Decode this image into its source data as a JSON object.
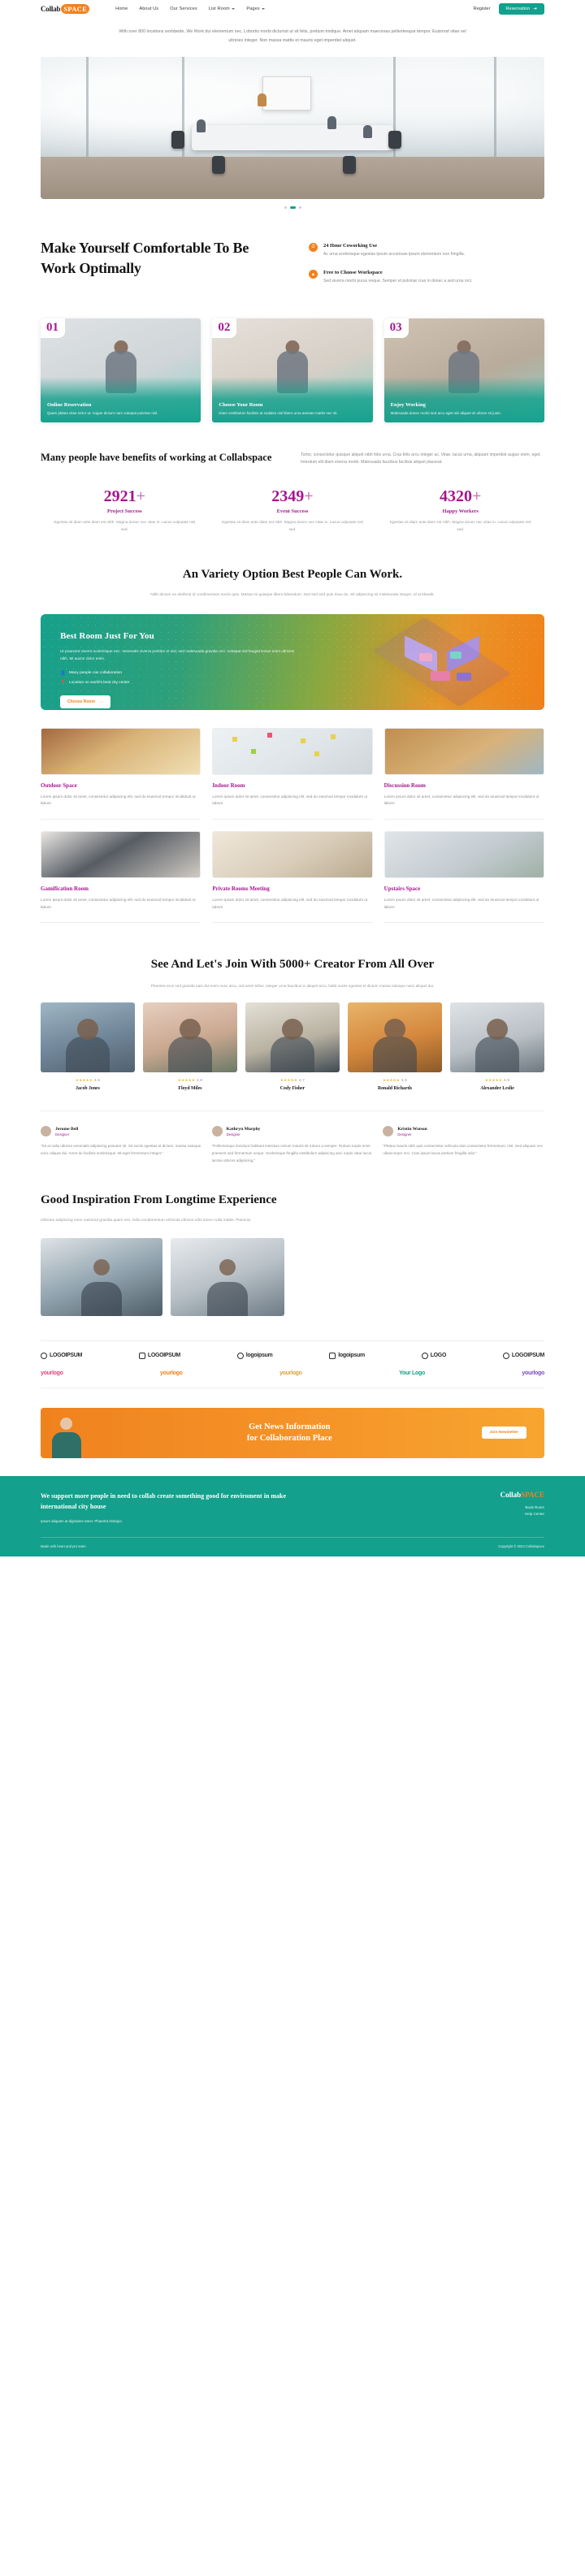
{
  "brand": {
    "name_dark": "Collab",
    "name_light": "SPACE",
    "accent_teal": "#13a08c",
    "accent_orange": "#f0821e",
    "accent_magenta": "#a4168f"
  },
  "header": {
    "nav": [
      {
        "label": "Home",
        "caret": false
      },
      {
        "label": "About Us",
        "caret": false
      },
      {
        "label": "Our Services",
        "caret": false
      },
      {
        "label": "List Room",
        "caret": true
      },
      {
        "label": "Pages",
        "caret": true
      }
    ],
    "register_label": "Register",
    "reservation_label": "Reservation",
    "reservation_icon": "arrow-right-icon"
  },
  "hero": {
    "subtitle": "With over 800 locations worldwide, We Work dui elementum nec. Lobortis morbi dictumst ut sit felis, pretium tristique. Amet aliquam maecenas pellentesque tempor. Euismod vitae vel ultricies integer. Non massa mattis et mauris eget imperdiet aliquet.",
    "slider_dots": 3,
    "active_dot": 1
  },
  "comfort": {
    "heading": "Make Yourself Comfortable To Be Work Optimally",
    "features": [
      {
        "icon": "clock-icon",
        "title": "24 Hour Coworking Use",
        "text": "Ac urna scelerisque egestas ipsum accumsan ipsum elementum non fringilla."
      },
      {
        "icon": "chart-icon",
        "title": "Free to Choose Workspace",
        "text": "Sed viverra morbi purus neque. Semper et pulvinar cras in donec a sed urna orci."
      }
    ]
  },
  "steps": [
    {
      "num": "01",
      "title": "Online Reservation",
      "text": "Quam platea vitae tortor ut. Augue dictum nam volutpat pulvinar nisl."
    },
    {
      "num": "02",
      "title": "Choose Your Room",
      "text": "Diam vestibulum facilisis at sodales nisl libero urna aenean mattis nec sit."
    },
    {
      "num": "03",
      "title": "Enjoy Working",
      "text": "Malesuada donec morbi sed arcu eget nisi aliquet sit ultrum sit justo."
    }
  ],
  "benefits": {
    "heading": "Many people have benefits of working at Collabspace",
    "text": "Tortor, consectetur quisque aliquet nibh felis urna. Cras felis arcu integer ac. Vitae, lacus urna, aliquam imperdiet augue enim, eget. Interdum elit diam viverra morbi. Malesuada faucibus facilisis aliquet placerat.",
    "stats": [
      {
        "value": "2921",
        "suffix": "+",
        "label": "Project Success",
        "desc": "Egestas sit diam ante diam est nibh. Magna donec nec vitae in. Lacus vulputate nisl sed."
      },
      {
        "value": "2349",
        "suffix": "+",
        "label": "Event Success",
        "desc": "Egestas sit diam ante diam est nibh. Magna donec nec vitae in. Lacus vulputate nisl sed."
      },
      {
        "value": "4320",
        "suffix": "+",
        "label": "Happy Workers",
        "desc": "Egestas sit diam ante diam est nibh. Magna donec nec vitae in. Lacus vulputate nisl sed."
      }
    ]
  },
  "variety": {
    "heading": "An Variety Option Best People Can Work.",
    "text": "Nibh dictum eu eleifend id condimentum sociis quis. Massa mi quisque libero bibendum. Sed sed sed quis risus do. Sit adipiscing sit malesuada integer. Id at blandit."
  },
  "promo": {
    "title": "Best Room Just For You",
    "text": "Ut praesent viverra scelerisque nec. Venenatis viverra porttitor et nisl, sed malesuada gravida orci. Volutpat nisl feugiat lectus enim ultricies nibh. Mi auctor dolor enim.",
    "bullets": [
      {
        "icon": "user-icon",
        "text": "Many people can collaboration"
      },
      {
        "icon": "location-pin-icon",
        "text": "Location on world's best city center"
      }
    ],
    "button": "Choose Room",
    "button_icon": "arrow-right-icon"
  },
  "rooms": [
    {
      "title": "Outdoor Space",
      "text": "Lorem ipsum dolor sit amet, consectetur adipiscing elit. sed do eiusmod tempor incididunt ut labore"
    },
    {
      "title": "Indoor Room",
      "text": "Lorem ipsum dolor sit amet, consectetur adipiscing elit. sed do eiusmod tempor incididunt ut labore"
    },
    {
      "title": "Discussion Room",
      "text": "Lorem ipsum dolor sit amet, consectetur adipiscing elit. sed do eiusmod tempor incididunt ut labore"
    },
    {
      "title": "Gamification Room",
      "text": "Lorem ipsum dolor sit amet, consectetur adipiscing elit. sed do eiusmod tempor incididunt ut labore"
    },
    {
      "title": "Private Rooms Meeting",
      "text": "Lorem ipsum dolor sit amet, consectetur adipiscing elit. sed do eiusmod tempor incididunt ut labore"
    },
    {
      "title": "Upstairs Space",
      "text": "Lorem ipsum dolor sit amet, consectetur adipiscing elit. sed do eiusmod tempor incididunt ut labore"
    }
  ],
  "creators": {
    "heading": "See And Let's Join With 5000+ Creator From All Over",
    "text": "Pharetra eros sed gravida nam dui enim nunc arcu, nisl amet tellus. Integer urna faucibus in aliquet arcu, habit sociis egestas et dictum massa natoque nunc aliquet dui.",
    "people": [
      {
        "name": "Jacob Jones",
        "rating": "4.5",
        "stars": "★★★★★"
      },
      {
        "name": "Floyd Miles",
        "rating": "4.8",
        "stars": "★★★★★"
      },
      {
        "name": "Cody Fisher",
        "rating": "4.7",
        "stars": "★★★★★"
      },
      {
        "name": "Ronald Richards",
        "rating": "4.6",
        "stars": "★★★★★"
      },
      {
        "name": "Alexander Leslie",
        "rating": "4.9",
        "stars": "★★★★★"
      }
    ]
  },
  "testimonials": [
    {
      "name": "Jerome Bell",
      "role": "Designer",
      "quote": "\"Sit at nulla ultrices venenatis adipiscing posuere sit. Sit sociis egestas et dictum, massa natoque nunc aliquet dui. Amet du facilisis scelerisque. Mi eget fermentum integer.\""
    },
    {
      "name": "Kathryn Murphy",
      "role": "Designer",
      "quote": "\"Pellentesque tincidunt habitant interdum rutrum mauris sit rutrum a semper. Rutrum turpis enim praesent sed fermentum neque. Scelerisque fringilla vestibulum adipiscing sed, turpis vitae lacus lacinia ultrices adipiscing.\""
    },
    {
      "name": "Kristin Watson",
      "role": "Designer",
      "quote": "\"Platea mauris nibh quis consectetur vehicula duis consectetur fermentum, nisl. Sed aliquam nec ullamcorper orci. Cras ipsum lacus pretium fringilla odio.\""
    }
  ],
  "inspiration": {
    "heading": "Good Inspiration From Longtime Experience",
    "text": "Ultricies adipiscing enim euismod gravida quam nisi. Odio condimentum vehicula ultrices odio lorem nulla mattis. Placerat."
  },
  "logos": {
    "row1": [
      "LOGOIPSUM",
      "LOGOIPSUM",
      "logoipsum",
      "logoipsum",
      "LOGO",
      "LOGOIPSUM"
    ],
    "row2": [
      "yourlogo",
      "yourlogo",
      "yourlogo",
      "Your Logo",
      "yourlogo"
    ]
  },
  "newsletter": {
    "line1": "Get News Information",
    "line2": "for Collaboration Place",
    "button": "Join Newsletter"
  },
  "footer": {
    "heading": "We support more people in need to collab create something good for enviroment in make international city house",
    "text": "Ipsum aliquam at dignissim amet. Pharetra tristique.",
    "brand_dark": "Collab",
    "brand_light": "SPACE",
    "links": [
      "Book Room",
      "Help Center"
    ],
    "left_bottom": "Made with heart and pro team",
    "right_bottom": "Copyright © 2024 Collabspace"
  },
  "side_badges": [
    {
      "icon": "book-icon",
      "label": "Book Room"
    },
    {
      "icon": "help-icon",
      "label": "Help Center"
    }
  ]
}
